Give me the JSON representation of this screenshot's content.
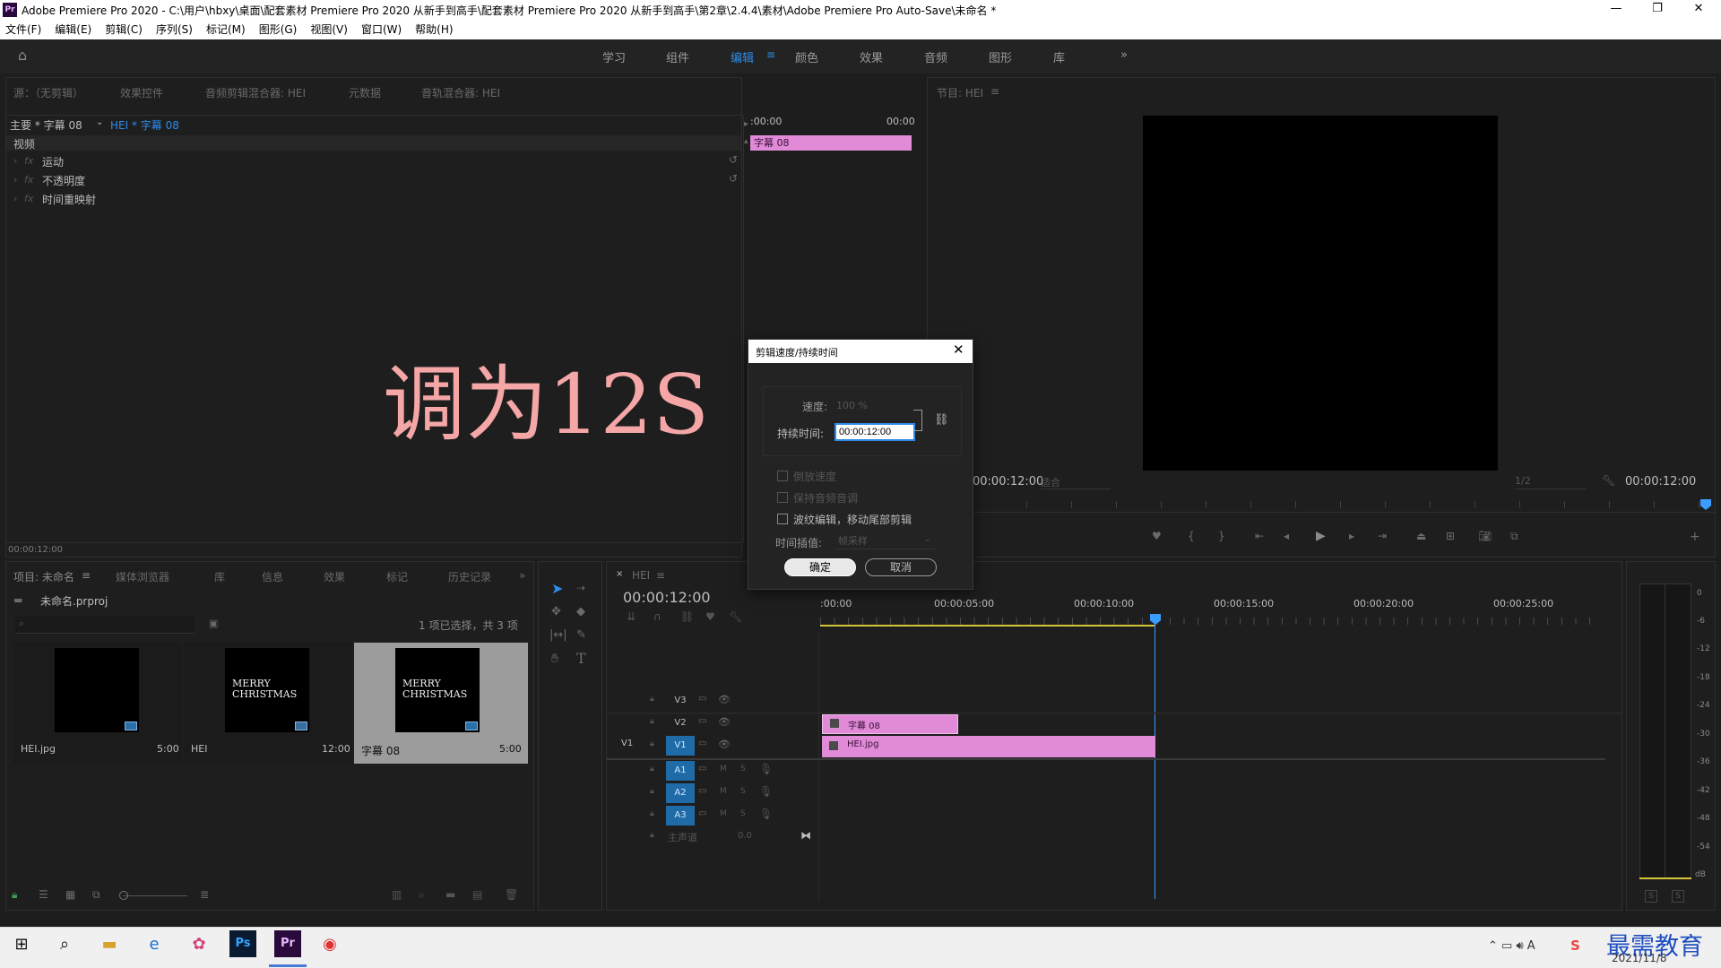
{
  "window": {
    "title": "Adobe Premiere Pro 2020 - C:\\用户\\hbxy\\桌面\\配套素材 Premiere Pro 2020 从新手到高手\\配套素材 Premiere Pro 2020 从新手到高手\\第2章\\2.4.4\\素材\\Adobe Premiere Pro Auto-Save\\未命名 *",
    "app_badge": "Pr",
    "minimize": "—",
    "restore": "❐",
    "close": "✕"
  },
  "menu": [
    "文件(F)",
    "编辑(E)",
    "剪辑(C)",
    "序列(S)",
    "标记(M)",
    "图形(G)",
    "视图(V)",
    "窗口(W)",
    "帮助(H)"
  ],
  "workspaces": {
    "items": [
      "学习",
      "组件",
      "编辑",
      "颜色",
      "效果",
      "音频",
      "图形",
      "库"
    ],
    "active": "编辑",
    "overflow": "»"
  },
  "effect_controls": {
    "tabs": [
      "源：（无剪辑）",
      "效果控件",
      "音频剪辑混合器: HEI",
      "元数据",
      "音轨混合器: HEI"
    ],
    "source_selector": "主要 * 字幕 08",
    "clip_selector": "HEI * 字幕 08",
    "time_start": ":00:00",
    "time_end": "00:00",
    "clip_label": "字幕 08",
    "section": "视频",
    "fx": [
      "运动",
      "不透明度",
      "时间重映射"
    ],
    "fx_badge": "fx",
    "timecode": "00:00:12:00"
  },
  "overlay_text": "调为12S",
  "program": {
    "tab": "节目: HEI",
    "timecode_left": "00:00:12:00",
    "fit": "适合",
    "resolution": "1/2",
    "timecode_right": "00:00:12:00"
  },
  "dialog": {
    "title": "剪辑速度/持续时间",
    "speed_label": "速度:",
    "speed_value": "100 %",
    "duration_label": "持续时间:",
    "duration_value": "00:00:12:00",
    "checks": [
      "倒放速度",
      "保持音频音调",
      "波纹编辑，移动尾部剪辑"
    ],
    "interp_label": "时间插值:",
    "interp_value": "帧采样",
    "ok": "确定",
    "cancel": "取消"
  },
  "project": {
    "tabs": [
      "项目: 未命名",
      "媒体浏览器",
      "库",
      "信息",
      "效果",
      "标记",
      "历史记录"
    ],
    "file": "未命名.prproj",
    "selection": "1 项已选择，共 3 项",
    "items": [
      {
        "name": "HEI.jpg",
        "duration": "5:00",
        "text": ""
      },
      {
        "name": "HEI",
        "duration": "12:00",
        "text": "MERRY CHRISTMAS"
      },
      {
        "name": "字幕 08",
        "duration": "5:00",
        "text": "MERRY CHRISTMAS"
      }
    ]
  },
  "timeline": {
    "tab": "HEI",
    "timecode": "00:00:12:00",
    "ruler": [
      ":00:00",
      "00:00:05:00",
      "00:00:10:00",
      "00:00:15:00",
      "00:00:20:00",
      "00:00:25:00"
    ],
    "tracks": [
      "V3",
      "V2",
      "V1",
      "A1",
      "A2",
      "A3"
    ],
    "source_patch": "V1",
    "master": "主声道",
    "master_value": "0.0",
    "clips": {
      "v2": "字幕 08",
      "v1": "HEI.jpg"
    },
    "mute": "M",
    "solo": "S"
  },
  "meter": {
    "scale": [
      "0",
      "-6",
      "-12",
      "-18",
      "-24",
      "-30",
      "-36",
      "-42",
      "-48",
      "-54",
      "dB"
    ],
    "solo_left": "S",
    "solo_right": "S"
  },
  "taskbar": {
    "date": "2021/11/8",
    "watermark": "最需教育",
    "ime": "S"
  },
  "colors": {
    "clip_pink": "#e08ad8",
    "accent_blue": "#2d8ceb",
    "playhead": "#3b9cff",
    "overlay_pink": "#f5a6a6"
  }
}
